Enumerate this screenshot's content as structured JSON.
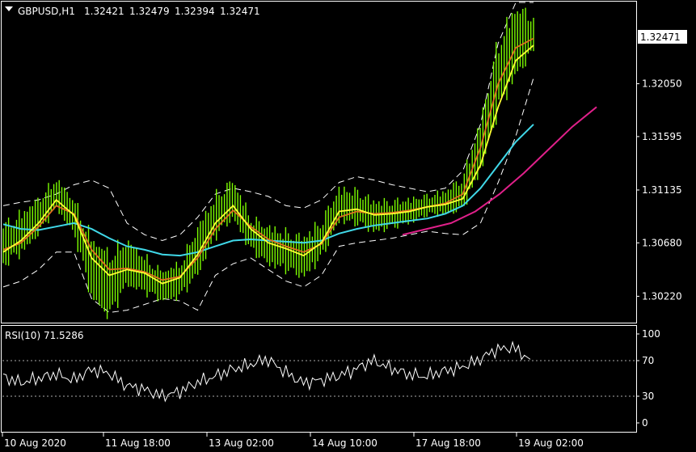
{
  "header": {
    "symbol": "GBPUSD,H1",
    "open": "1.32421",
    "high": "1.32479",
    "low": "1.32394",
    "close": "1.32471"
  },
  "price_axis": {
    "ticks": [
      "1.32050",
      "1.31595",
      "1.31135",
      "1.30680",
      "1.30220"
    ],
    "current": "1.32471"
  },
  "rsi": {
    "label": "RSI(10) 71.5286",
    "ticks": [
      "100",
      "70",
      "30",
      "0"
    ]
  },
  "time_axis": {
    "ticks": [
      "10 Aug 2020",
      "11 Aug 18:00",
      "13 Aug 02:00",
      "14 Aug 10:00",
      "17 Aug 18:00",
      "19 Aug 02:00"
    ]
  },
  "colors": {
    "candles": "#7CFC00",
    "ema_fast": "#FFFF33",
    "ema_mid": "#E07020",
    "ma_slow": "#40D8E8",
    "bands": "#FFFFFF",
    "trendline": "#E0208A",
    "rsi_line": "#FFFFFF"
  },
  "chart_data": [
    {
      "type": "line",
      "title": "GBPUSD,H1",
      "ylim": [
        1.3,
        1.3275
      ],
      "yticks": [
        1.3022,
        1.3068,
        1.31135,
        1.31595,
        1.3205
      ],
      "x": [
        "10 Aug 2020",
        "11 Aug 18:00",
        "13 Aug 02:00",
        "14 Aug 10:00",
        "17 Aug 18:00",
        "19 Aug 02:00"
      ],
      "series": [
        {
          "key": "close",
          "values": [
            1.3065,
            1.3075,
            1.309,
            1.311,
            1.309,
            1.3045,
            1.303,
            1.305,
            1.304,
            1.303,
            1.3035,
            1.306,
            1.309,
            1.3105,
            1.3075,
            1.3065,
            1.306,
            1.3055,
            1.307,
            1.31,
            1.3098,
            1.309,
            1.3092,
            1.3095,
            1.31,
            1.3102,
            1.311,
            1.315,
            1.321,
            1.324,
            1.3247
          ]
        },
        {
          "key": "ema_fast",
          "values": [
            1.306,
            1.307,
            1.3085,
            1.3105,
            1.3092,
            1.3055,
            1.304,
            1.3045,
            1.3042,
            1.3033,
            1.3038,
            1.3058,
            1.3085,
            1.31,
            1.308,
            1.3068,
            1.3063,
            1.3057,
            1.3068,
            1.3095,
            1.3097,
            1.3092,
            1.3093,
            1.3095,
            1.3099,
            1.3101,
            1.3106,
            1.3135,
            1.3185,
            1.3225,
            1.3238
          ]
        },
        {
          "key": "ema_mid",
          "values": [
            1.3062,
            1.3068,
            1.3082,
            1.31,
            1.3093,
            1.3062,
            1.3045,
            1.3046,
            1.3043,
            1.3036,
            1.3039,
            1.3055,
            1.308,
            1.3096,
            1.3082,
            1.3071,
            1.3065,
            1.306,
            1.3067,
            1.309,
            1.3095,
            1.3093,
            1.3094,
            1.3096,
            1.3099,
            1.3102,
            1.311,
            1.315,
            1.3205,
            1.3236,
            1.3244
          ]
        },
        {
          "key": "ma_slow",
          "values": [
            1.3084,
            1.308,
            1.3079,
            1.3082,
            1.3085,
            1.308,
            1.3072,
            1.3065,
            1.3062,
            1.3058,
            1.3057,
            1.306,
            1.3065,
            1.307,
            1.3071,
            1.307,
            1.3069,
            1.3068,
            1.307,
            1.3076,
            1.308,
            1.3083,
            1.3085,
            1.3087,
            1.3089,
            1.3093,
            1.31,
            1.3115,
            1.3135,
            1.3155,
            1.317
          ]
        },
        {
          "key": "band_upper",
          "values": [
            1.31,
            1.3103,
            1.3105,
            1.311,
            1.3118,
            1.3122,
            1.3115,
            1.3085,
            1.3075,
            1.307,
            1.3075,
            1.309,
            1.311,
            1.3115,
            1.3112,
            1.3108,
            1.31,
            1.3098,
            1.3105,
            1.312,
            1.3125,
            1.3122,
            1.3118,
            1.3115,
            1.3112,
            1.3115,
            1.313,
            1.317,
            1.324,
            1.3275,
            1.3275
          ]
        },
        {
          "key": "band_lower",
          "values": [
            1.303,
            1.3035,
            1.3045,
            1.306,
            1.306,
            1.302,
            1.3008,
            1.301,
            1.3015,
            1.302,
            1.3018,
            1.301,
            1.304,
            1.305,
            1.3055,
            1.3045,
            1.3035,
            1.303,
            1.304,
            1.3065,
            1.3068,
            1.307,
            1.3072,
            1.3075,
            1.3078,
            1.3076,
            1.3075,
            1.3085,
            1.312,
            1.316,
            1.321
          ]
        },
        {
          "key": "trendline",
          "values_from_index": 22,
          "values": [
            1.3075,
            1.308,
            1.3085,
            1.3095,
            1.311,
            1.3128,
            1.3148,
            1.3168,
            1.3185
          ]
        }
      ]
    },
    {
      "type": "line",
      "title": "RSI(10) 71.5286",
      "ylim": [
        0,
        100
      ],
      "yticks": [
        0,
        30,
        70,
        100
      ],
      "levels": [
        30,
        70
      ],
      "values": [
        52,
        45,
        50,
        55,
        48,
        60,
        56,
        42,
        38,
        30,
        35,
        45,
        52,
        60,
        65,
        72,
        58,
        45,
        48,
        52,
        60,
        70,
        62,
        55,
        52,
        58,
        62,
        70,
        82,
        85,
        71.5
      ]
    }
  ]
}
